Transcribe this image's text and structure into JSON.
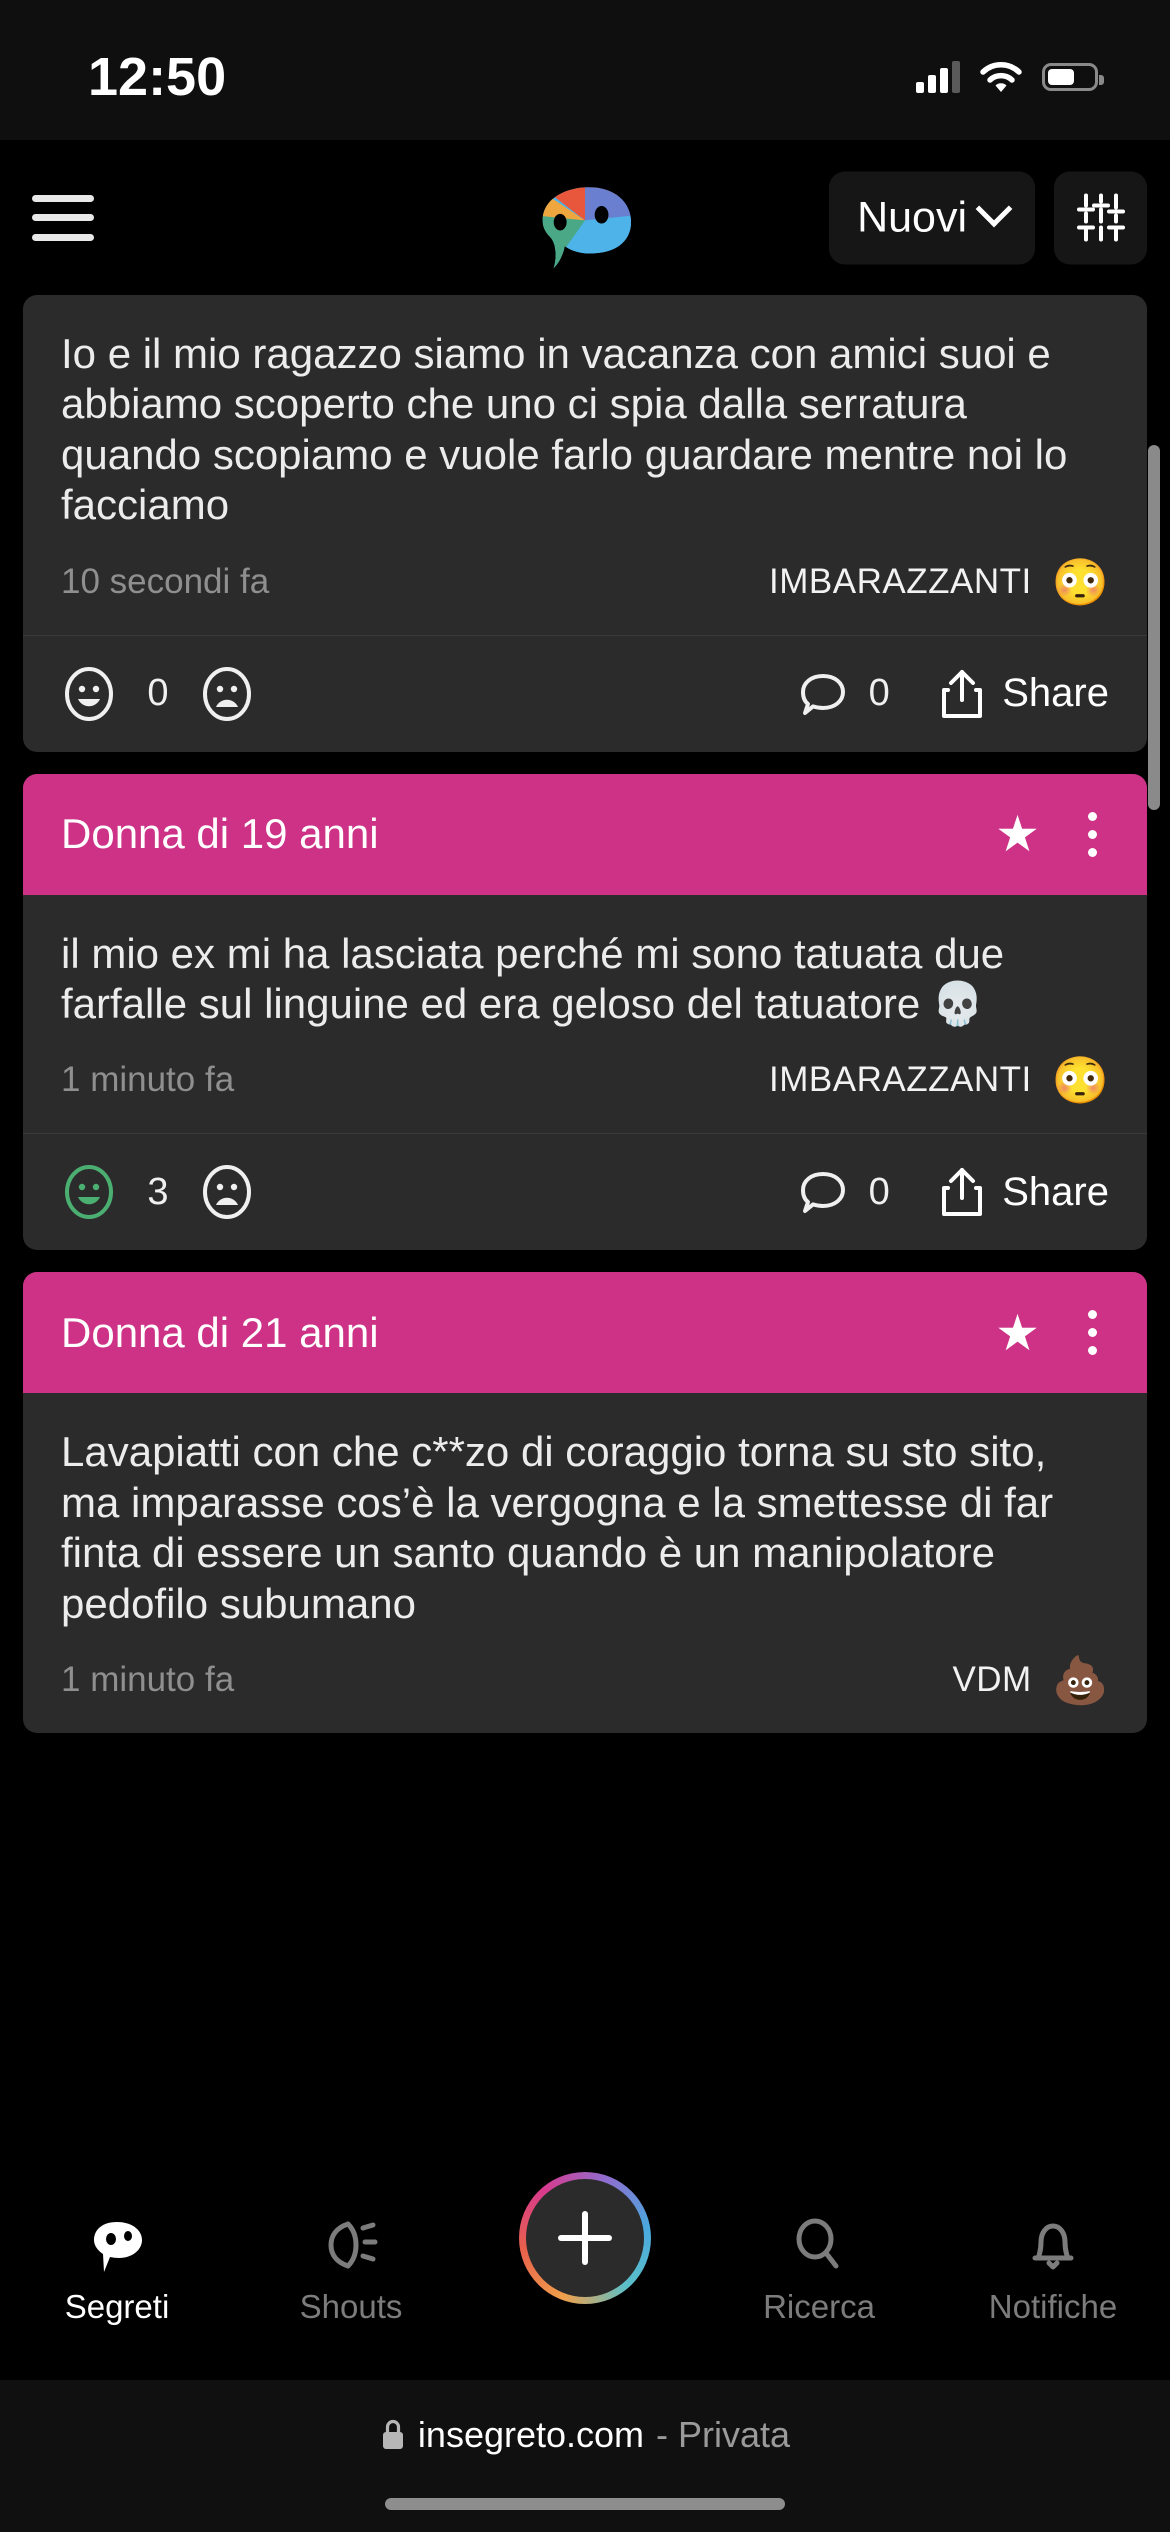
{
  "status_bar": {
    "time": "12:50",
    "signal_icon": "cellular-signal-icon",
    "wifi_icon": "wifi-icon",
    "battery_icon": "battery-icon"
  },
  "header": {
    "menu_icon": "hamburger-menu-icon",
    "logo_icon": "insegreto-parrot-logo",
    "sort_label": "Nuovi",
    "chevron_icon": "chevron-down-icon",
    "filter_icon": "sliders-filter-icon"
  },
  "theme": {
    "page_bg": "#000000",
    "card_bg": "#2b2b2b",
    "accent_pink": "#cd3287",
    "like_active_green": "#4caf72",
    "muted_text": "#8f8f8f"
  },
  "feed": {
    "cards": [
      {
        "header_visible": false,
        "title": "",
        "text": "Io e il mio ragazzo siamo in vacanza con amici suoi e abbiamo scoperto che uno ci spia dalla serratura quando scopiamo e vuole farlo guardare mentre noi lo facciamo",
        "ago": "10 secondi fa",
        "category": "IMBARAZZANTI",
        "category_emoji": "😳",
        "like_count": "0",
        "like_active": false,
        "comment_count": "0",
        "share_label": "Share"
      },
      {
        "header_visible": true,
        "title": "Donna di 19 anni",
        "text": "il mio ex mi ha lasciata perché mi sono tatuata due farfalle sul linguine ed era geloso del tatuatore 💀",
        "ago": "1 minuto fa",
        "category": "IMBARAZZANTI",
        "category_emoji": "😳",
        "like_count": "3",
        "like_active": true,
        "comment_count": "0",
        "share_label": "Share"
      },
      {
        "header_visible": true,
        "title": "Donna di 21 anni",
        "text": "Lavapiatti con che c**zo di coraggio torna su sto sito, ma imparasse cos’è la vergogna e la smettesse di far finta di essere un santo quando è un manipolatore pedofilo subumano",
        "ago": "1 minuto fa",
        "category": "VDM",
        "category_emoji": "💩",
        "like_count": "",
        "like_active": false,
        "comment_count": "",
        "share_label": ""
      }
    ],
    "icons": {
      "star": "star-icon",
      "kebab": "more-options-icon",
      "like": "smiley-face-icon",
      "dislike": "sad-face-icon",
      "comment": "comment-bubble-icon",
      "share": "share-arrow-icon"
    }
  },
  "bottom_nav": {
    "items": [
      {
        "label": "Segreti",
        "icon": "secrets-speech-icon",
        "active": true
      },
      {
        "label": "Shouts",
        "icon": "shout-megaphone-icon",
        "active": false
      },
      {
        "label": "Ricerca",
        "icon": "search-icon",
        "active": false
      },
      {
        "label": "Notifiche",
        "icon": "bell-icon",
        "active": false
      }
    ],
    "fab": {
      "icon": "plus-icon",
      "label": "+"
    }
  },
  "safari_bar": {
    "lock_icon": "lock-icon",
    "domain": "insegreto.com",
    "private_label": "- Privata"
  }
}
